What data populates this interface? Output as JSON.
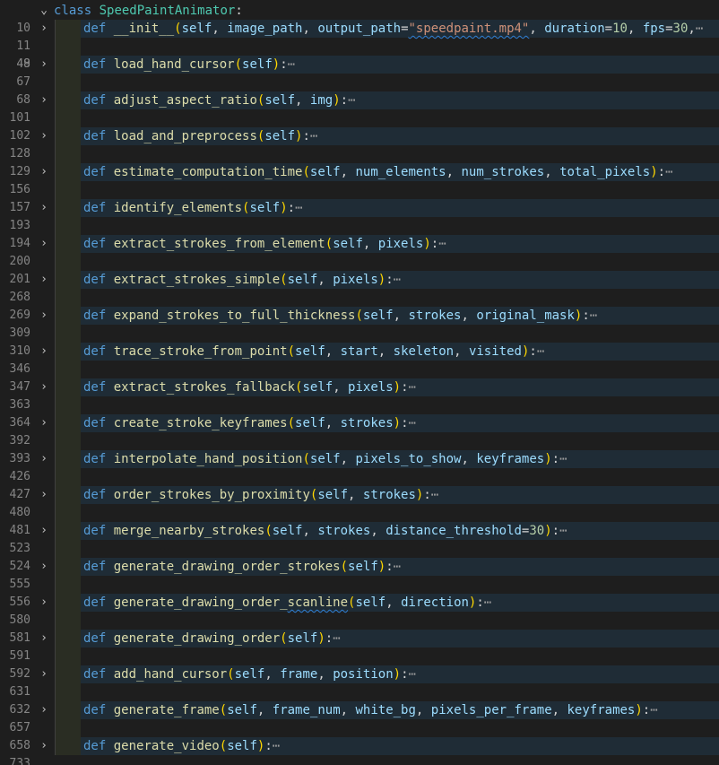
{
  "class_line": {
    "number": "10",
    "fold": "⌄",
    "keyword": "class",
    "name": "SpeedPaintAnimator",
    "colon": ":"
  },
  "init_line": {
    "number": "11",
    "fold": "›",
    "def": "def",
    "name": "__init__",
    "open": "(",
    "segments": [
      {
        "t": "self",
        "c": "prm"
      },
      {
        "t": ", ",
        "c": ""
      },
      {
        "t": "image_path",
        "c": "prm"
      },
      {
        "t": ", ",
        "c": ""
      },
      {
        "t": "output_path",
        "c": "prm"
      },
      {
        "t": "=",
        "c": ""
      },
      {
        "t": "\"speedpaint.mp4\"",
        "c": "str sq"
      },
      {
        "t": ", ",
        "c": ""
      },
      {
        "t": "duration",
        "c": "prm"
      },
      {
        "t": "=",
        "c": ""
      },
      {
        "t": "10",
        "c": "num"
      },
      {
        "t": ", ",
        "c": ""
      },
      {
        "t": "fps",
        "c": "prm"
      },
      {
        "t": "=",
        "c": ""
      },
      {
        "t": "30",
        "c": "num"
      },
      {
        "t": ",",
        "c": ""
      }
    ],
    "ellipsis": "⋯"
  },
  "methods": [
    {
      "num": "49",
      "after": "67",
      "name": "load_hand_cursor",
      "params": "self"
    },
    {
      "num": "68",
      "after": "101",
      "name": "adjust_aspect_ratio",
      "params": "self, img"
    },
    {
      "num": "102",
      "after": "128",
      "name": "load_and_preprocess",
      "params": "self"
    },
    {
      "num": "129",
      "after": "156",
      "name": "estimate_computation_time",
      "params": "self, num_elements, num_strokes, total_pixels"
    },
    {
      "num": "157",
      "after": "193",
      "name": "identify_elements",
      "params": "self"
    },
    {
      "num": "194",
      "after": "200",
      "name": "extract_strokes_from_element",
      "params": "self, pixels"
    },
    {
      "num": "201",
      "after": "268",
      "name": "extract_strokes_simple",
      "params": "self, pixels"
    },
    {
      "num": "269",
      "after": "309",
      "name": "expand_strokes_to_full_thickness",
      "params": "self, strokes, original_mask"
    },
    {
      "num": "310",
      "after": "346",
      "name": "trace_stroke_from_point",
      "params": "self, start, skeleton, visited"
    },
    {
      "num": "347",
      "after": "363",
      "name": "extract_strokes_fallback",
      "params": "self, pixels"
    },
    {
      "num": "364",
      "after": "392",
      "name": "create_stroke_keyframes",
      "params": "self, strokes"
    },
    {
      "num": "393",
      "after": "426",
      "name": "interpolate_hand_position",
      "params": "self, pixels_to_show, keyframes"
    },
    {
      "num": "427",
      "after": "480",
      "name": "order_strokes_by_proximity",
      "params": "self, strokes"
    },
    {
      "num": "481",
      "after": "523",
      "name": "merge_nearby_strokes",
      "params": "self, strokes, distance_threshold=30"
    },
    {
      "num": "524",
      "after": "555",
      "name": "generate_drawing_order_strokes",
      "params": "self"
    },
    {
      "num": "556",
      "after": "580",
      "name": "generate_drawing_order_scanline",
      "params": "self, direction"
    },
    {
      "num": "581",
      "after": "591",
      "name": "generate_drawing_order",
      "params": "self"
    },
    {
      "num": "592",
      "after": "631",
      "name": "add_hand_cursor",
      "params": "self, frame, position"
    },
    {
      "num": "632",
      "after": "657",
      "name": "generate_frame",
      "params": "self, frame_num, white_bg, pixels_per_frame, keyframes"
    },
    {
      "num": "658",
      "after": "733",
      "name": "generate_video",
      "params": "self"
    }
  ],
  "first_blank_number": "48",
  "fold_glyph": "›",
  "def_keyword": "def",
  "open_paren": "(",
  "close_paren": ")",
  "colon": ":",
  "ellipsis": "⋯"
}
